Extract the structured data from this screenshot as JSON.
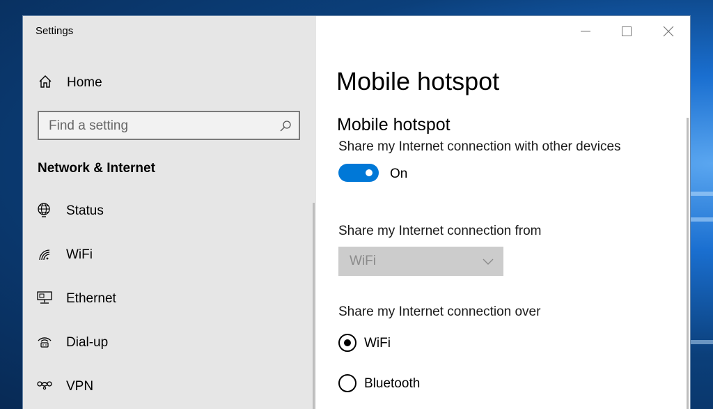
{
  "window": {
    "title": "Settings"
  },
  "sidebar": {
    "home_label": "Home",
    "search": {
      "placeholder": "Find a setting"
    },
    "section_title": "Network & Internet",
    "items": [
      {
        "label": "Status",
        "icon": "globe-icon"
      },
      {
        "label": "WiFi",
        "icon": "wifi-icon"
      },
      {
        "label": "Ethernet",
        "icon": "ethernet-icon"
      },
      {
        "label": "Dial-up",
        "icon": "dialup-icon"
      },
      {
        "label": "VPN",
        "icon": "vpn-icon"
      }
    ]
  },
  "content": {
    "page_title": "Mobile hotspot",
    "section_title": "Mobile hotspot",
    "share_label": "Share my Internet connection with other devices",
    "toggle": {
      "state_label": "On",
      "on": true
    },
    "from_label": "Share my Internet connection from",
    "from_value": "WiFi",
    "over_label": "Share my Internet connection over",
    "over_options": [
      {
        "label": "WiFi",
        "selected": true
      },
      {
        "label": "Bluetooth",
        "selected": false
      }
    ]
  },
  "colors": {
    "accent": "#0078d7",
    "sidebar_bg": "#e6e6e6"
  }
}
